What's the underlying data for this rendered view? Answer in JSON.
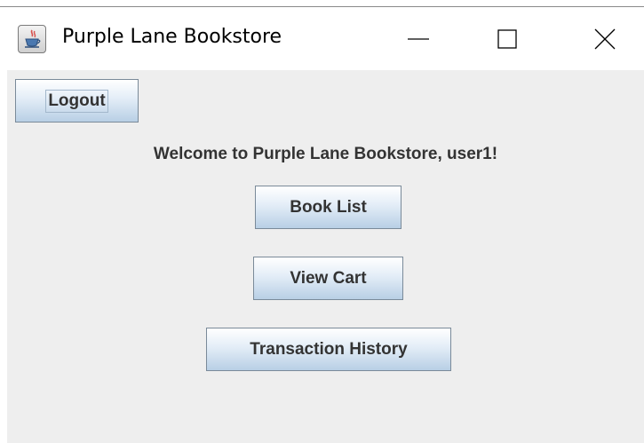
{
  "window": {
    "title": "Purple Lane Bookstore",
    "icon": "java-cup-icon"
  },
  "controls": {
    "minimize_icon": "minimize-icon",
    "maximize_icon": "maximize-icon",
    "close_icon": "close-icon"
  },
  "main": {
    "logout_label": "Logout",
    "welcome_text": "Welcome to Purple Lane Bookstore, user1!",
    "book_list_label": "Book List",
    "view_cart_label": "View Cart",
    "transaction_history_label": "Transaction History"
  },
  "colors": {
    "panel_background": "#eeeeee",
    "button_gradient_top": "#ffffff",
    "button_gradient_bottom": "#b8cfe5",
    "button_border": "#7a8a99",
    "text": "#333333"
  }
}
